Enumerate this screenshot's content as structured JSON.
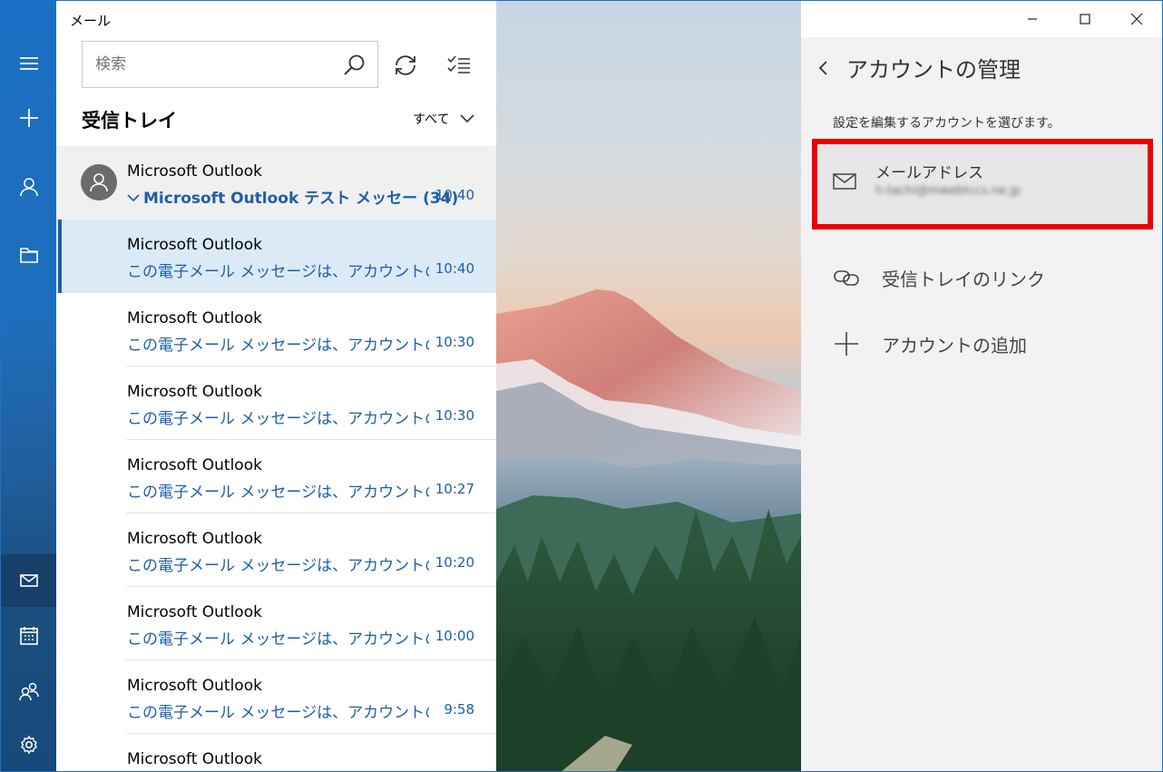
{
  "app": {
    "title": "メール"
  },
  "search": {
    "placeholder": "検索"
  },
  "folder": {
    "title": "受信トレイ",
    "filter": "すべて"
  },
  "thread": {
    "sender": "Microsoft Outlook",
    "subject": "Microsoft Outlook テスト メッセー",
    "count": "(34)",
    "time": "10:40"
  },
  "messages": [
    {
      "sender": "Microsoft Outlook",
      "preview": "この電子メール メッセージは、アカウントの設定の",
      "time": "10:40"
    },
    {
      "sender": "Microsoft Outlook",
      "preview": "この電子メール メッセージは、アカウントの設定の",
      "time": "10:30"
    },
    {
      "sender": "Microsoft Outlook",
      "preview": "この電子メール メッセージは、アカウントの設定の",
      "time": "10:30"
    },
    {
      "sender": "Microsoft Outlook",
      "preview": "この電子メール メッセージは、アカウントの設定の",
      "time": "10:27"
    },
    {
      "sender": "Microsoft Outlook",
      "preview": "この電子メール メッセージは、アカウントの設定の",
      "time": "10:20"
    },
    {
      "sender": "Microsoft Outlook",
      "preview": "この電子メール メッセージは、アカウントの設定の",
      "time": "10:00"
    },
    {
      "sender": "Microsoft Outlook",
      "preview": "この電子メール メッセージは、アカウントの設定の",
      "time": "9:58"
    },
    {
      "sender": "Microsoft Outlook",
      "preview": "",
      "time": ""
    }
  ],
  "flyout": {
    "title": "アカウントの管理",
    "description": "設定を編集するアカウントを選びます。",
    "account": {
      "label": "メールアドレス",
      "email": "h-tachi@mwebtccs.ne.jp"
    },
    "link_inboxes": "受信トレイのリンク",
    "add_account": "アカウントの追加"
  },
  "colors": {
    "accent": "#1d5fa8",
    "rail": "#1a6fc4",
    "highlight": "#ee0000"
  },
  "icons": [
    "hamburger-icon",
    "plus-icon",
    "person-icon",
    "folder-icon",
    "mail-icon",
    "calendar-icon",
    "people-icon",
    "gear-icon",
    "search-icon",
    "sync-icon",
    "select-icon",
    "chevron-down-icon",
    "back-icon",
    "link-icon",
    "minimize-icon",
    "maximize-icon",
    "close-icon"
  ]
}
